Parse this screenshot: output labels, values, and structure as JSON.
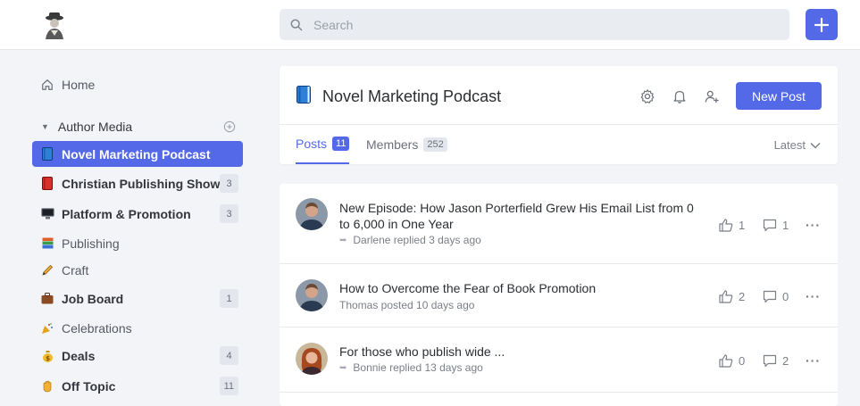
{
  "topbar": {
    "search_placeholder": "Search",
    "logo_icon": "author-portrait-logo",
    "add_icon": "plus-icon",
    "accent": "#5469e8"
  },
  "sidebar": {
    "home_label": "Home",
    "section_label": "Author Media",
    "items": [
      {
        "label": "Novel Marketing Podcast",
        "icon": "blue-book-icon",
        "active": true,
        "badge": ""
      },
      {
        "label": "Christian Publishing Show",
        "icon": "red-book-icon",
        "badge": "3"
      },
      {
        "label": "Platform & Promotion",
        "icon": "computer-icon",
        "badge": "3"
      },
      {
        "label": "Publishing",
        "icon": "books-icon",
        "badge": ""
      },
      {
        "label": "Craft",
        "icon": "pencil-icon",
        "badge": ""
      },
      {
        "label": "Job Board",
        "icon": "briefcase-icon",
        "badge": "1"
      },
      {
        "label": "Celebrations",
        "icon": "party-popper-icon",
        "badge": ""
      },
      {
        "label": "Deals",
        "icon": "money-bag-icon",
        "badge": "4"
      },
      {
        "label": "Off Topic",
        "icon": "waving-hand-icon",
        "badge": "11"
      }
    ]
  },
  "channel": {
    "title": "Novel Marketing Podcast",
    "new_post_label": "New Post",
    "tabs": [
      {
        "label": "Posts",
        "count": "11"
      },
      {
        "label": "Members",
        "count": "252"
      }
    ],
    "sort_label": "Latest"
  },
  "posts": [
    {
      "title": "New Episode: How Jason Porterfield Grew His Email List from 0 to 6,000 in One Year",
      "meta": "Darlene replied 3 days ago",
      "replied": true,
      "likes": "1",
      "comments": "1"
    },
    {
      "title": "How to Overcome the Fear of Book Promotion",
      "meta": "Thomas posted 10 days ago",
      "replied": false,
      "likes": "2",
      "comments": "0"
    },
    {
      "title": "For those who publish wide ...",
      "meta": "Bonnie replied 13 days ago",
      "replied": true,
      "likes": "0",
      "comments": "2"
    }
  ]
}
